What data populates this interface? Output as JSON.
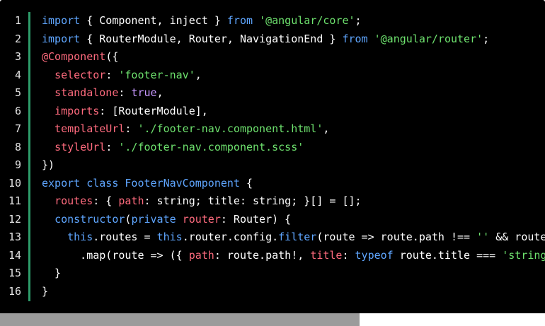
{
  "editor": {
    "line_numbers": [
      "1",
      "2",
      "3",
      "4",
      "5",
      "6",
      "7",
      "8",
      "9",
      "10",
      "11",
      "12",
      "13",
      "14",
      "15",
      "16"
    ],
    "lines": [
      [
        {
          "t": "kw",
          "v": "import"
        },
        {
          "t": "d",
          "v": " { Component, inject } "
        },
        {
          "t": "kw",
          "v": "from"
        },
        {
          "t": "d",
          "v": " "
        },
        {
          "t": "str",
          "v": "'@angular/core'"
        },
        {
          "t": "d",
          "v": ";"
        }
      ],
      [
        {
          "t": "kw",
          "v": "import"
        },
        {
          "t": "d",
          "v": " { RouterModule, Router, NavigationEnd } "
        },
        {
          "t": "kw",
          "v": "from"
        },
        {
          "t": "d",
          "v": " "
        },
        {
          "t": "str",
          "v": "'@angular/router'"
        },
        {
          "t": "d",
          "v": ";"
        }
      ],
      [
        {
          "t": "prop",
          "v": "@Component"
        },
        {
          "t": "d",
          "v": "({"
        }
      ],
      [
        {
          "t": "d",
          "v": "  "
        },
        {
          "t": "prop",
          "v": "selector"
        },
        {
          "t": "d",
          "v": ": "
        },
        {
          "t": "str",
          "v": "'footer-nav'"
        },
        {
          "t": "d",
          "v": ","
        }
      ],
      [
        {
          "t": "d",
          "v": "  "
        },
        {
          "t": "prop",
          "v": "standalone"
        },
        {
          "t": "d",
          "v": ": "
        },
        {
          "t": "bool",
          "v": "true"
        },
        {
          "t": "d",
          "v": ","
        }
      ],
      [
        {
          "t": "d",
          "v": "  "
        },
        {
          "t": "prop",
          "v": "imports"
        },
        {
          "t": "d",
          "v": ": [RouterModule],"
        }
      ],
      [
        {
          "t": "d",
          "v": "  "
        },
        {
          "t": "prop",
          "v": "templateUrl"
        },
        {
          "t": "d",
          "v": ": "
        },
        {
          "t": "str",
          "v": "'./footer-nav.component.html'"
        },
        {
          "t": "d",
          "v": ","
        }
      ],
      [
        {
          "t": "d",
          "v": "  "
        },
        {
          "t": "prop",
          "v": "styleUrl"
        },
        {
          "t": "d",
          "v": ": "
        },
        {
          "t": "str",
          "v": "'./footer-nav.component.scss'"
        }
      ],
      [
        {
          "t": "d",
          "v": "})"
        }
      ],
      [
        {
          "t": "kw",
          "v": "export"
        },
        {
          "t": "d",
          "v": " "
        },
        {
          "t": "kw",
          "v": "class"
        },
        {
          "t": "d",
          "v": " "
        },
        {
          "t": "kw",
          "v": "FooterNavComponent"
        },
        {
          "t": "d",
          "v": " {"
        }
      ],
      [
        {
          "t": "d",
          "v": "  "
        },
        {
          "t": "prop",
          "v": "routes"
        },
        {
          "t": "d",
          "v": ": { "
        },
        {
          "t": "prop",
          "v": "path"
        },
        {
          "t": "d",
          "v": ": string; title: string; }[] = [];"
        }
      ],
      [
        {
          "t": "d",
          "v": "  "
        },
        {
          "t": "kw",
          "v": "constructor"
        },
        {
          "t": "d",
          "v": "("
        },
        {
          "t": "kw",
          "v": "private"
        },
        {
          "t": "d",
          "v": " "
        },
        {
          "t": "prop",
          "v": "router"
        },
        {
          "t": "d",
          "v": ": Router) {"
        }
      ],
      [
        {
          "t": "d",
          "v": "    "
        },
        {
          "t": "kw",
          "v": "this"
        },
        {
          "t": "d",
          "v": ".routes = "
        },
        {
          "t": "kw",
          "v": "this"
        },
        {
          "t": "d",
          "v": ".router.config."
        },
        {
          "t": "kw",
          "v": "filter"
        },
        {
          "t": "d",
          "v": "(route => route.path !== "
        },
        {
          "t": "str",
          "v": "''"
        },
        {
          "t": "d",
          "v": " && route"
        }
      ],
      [
        {
          "t": "d",
          "v": "      .map(route => ({ "
        },
        {
          "t": "prop",
          "v": "path"
        },
        {
          "t": "d",
          "v": ": route.path!, "
        },
        {
          "t": "prop",
          "v": "title"
        },
        {
          "t": "d",
          "v": ": "
        },
        {
          "t": "kw",
          "v": "typeof"
        },
        {
          "t": "d",
          "v": " route.title === "
        },
        {
          "t": "str",
          "v": "'string'"
        }
      ],
      [
        {
          "t": "d",
          "v": "  }"
        }
      ],
      [
        {
          "t": "d",
          "v": "}"
        }
      ]
    ],
    "colors": {
      "background": "#000000",
      "keyword": "#5fa6ff",
      "string": "#6ee26e",
      "property": "#ff6b7e",
      "boolean": "#c798ff",
      "gutter_bar": "#2d9c6a"
    },
    "scrollbar": {
      "thumb_fraction": 0.66
    }
  }
}
